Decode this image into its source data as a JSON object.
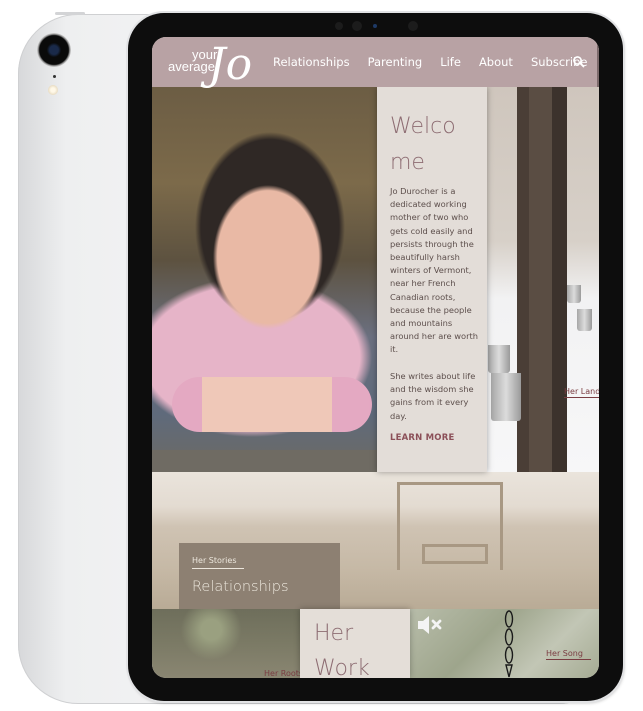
{
  "site": {
    "logo": {
      "line1": "your",
      "line2": "average",
      "script": "Jo"
    },
    "nav": {
      "links": [
        "Relationships",
        "Parenting",
        "Life",
        "About",
        "Subscribe"
      ],
      "search_icon": "search-icon"
    }
  },
  "hero": {
    "welcome": {
      "heading_line1": "Welco",
      "heading_line2": "me",
      "paragraph1": "Jo Durocher is a dedicated working mother of two who gets cold easily and persists through the beautifully harsh winters of Vermont, near her French Canadian roots, because the people and mountains around her are worth it.",
      "paragraph2": "She writes about life and the wisdom she gains from it every day.",
      "cta": "LEARN MORE"
    },
    "maple_tag": "Her Land"
  },
  "stories": {
    "kicker": "Her Stories",
    "title": "Relationships"
  },
  "bottom": {
    "woods_tag": "Her Roots",
    "work_line1": "Her",
    "work_line2": "Work",
    "song_tag": "Her Song",
    "mute_icon": "speaker-muted-icon"
  },
  "colors": {
    "nav_bg": "#b8a2a4",
    "accent": "#8b4f58",
    "heading": "#8d6c72",
    "panel_bg": "#e3ddd8",
    "stories_box": "#8d8072"
  }
}
